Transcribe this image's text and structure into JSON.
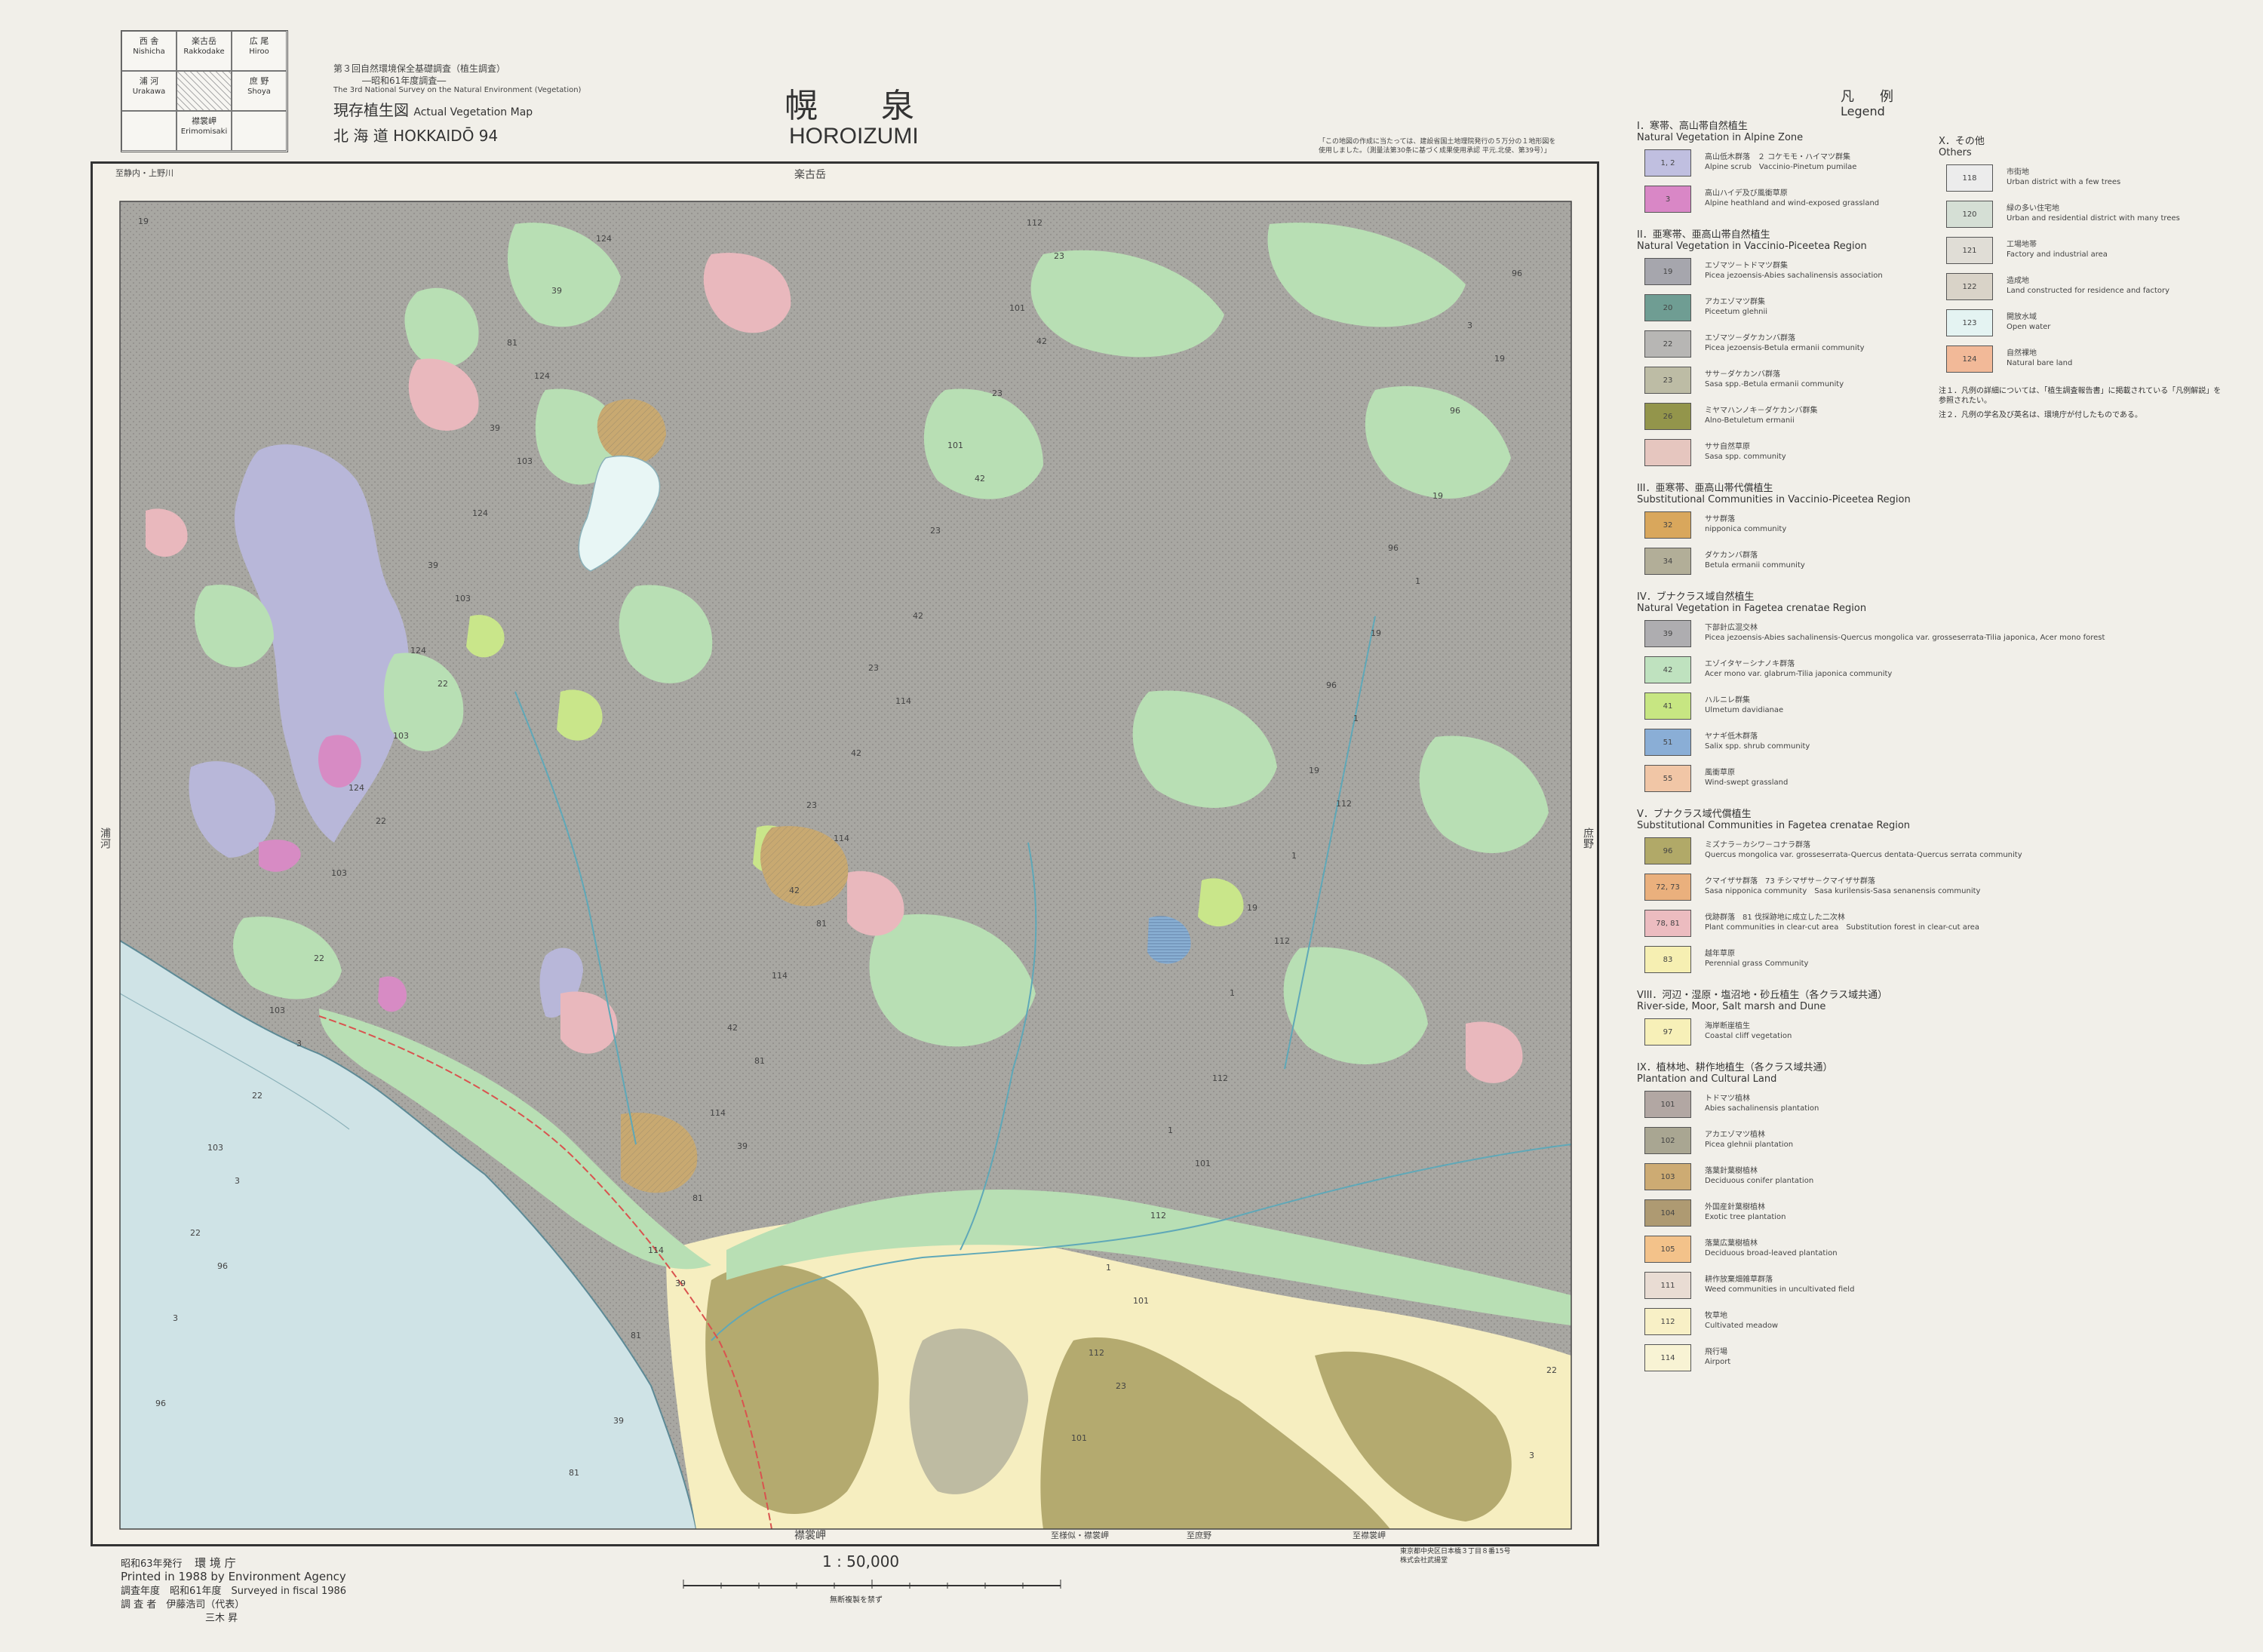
{
  "index_map": {
    "cells": [
      {
        "jp": "西 舎",
        "en": "Nishicha"
      },
      {
        "jp": "楽古岳",
        "en": "Rakkodake"
      },
      {
        "jp": "広 尾",
        "en": "Hiroo"
      },
      {
        "jp": "浦 河",
        "en": "Urakawa"
      },
      {
        "jp": "",
        "en": ""
      },
      {
        "jp": "庶 野",
        "en": "Shoya"
      },
      {
        "jp": "",
        "en": ""
      },
      {
        "jp": "襟裳岬",
        "en": "Erimomisaki"
      },
      {
        "jp": "",
        "en": ""
      }
    ]
  },
  "header": {
    "survey_jp": "第３回自然環境保全基礎調査（植生調査）",
    "year_jp": "―昭和61年度調査―",
    "survey_en": "The 3rd National Survey on the Natural Environment (Vegetation)",
    "map_type_jp": "現存植生図",
    "map_type_en": "Actual Vegetation Map",
    "region": "北 海 道 HOKKAIDŌ 94",
    "title_jp": "幌　泉",
    "title_en": "HOROIZUMI",
    "note_jp_1": "「この地図の作成に当たっては、建設省国土地理院発行の５万分の１地形図を",
    "note_jp_2": "使用しました。（測量法第30条に基づく成果使用承認 平元.北使、第39号）」"
  },
  "map": {
    "edge_top": "楽古岳",
    "edge_bottom": "襟裳岬",
    "edge_left": "浦河",
    "edge_right": "庶野",
    "top_left_ref": "至静内・上野川",
    "bottom_refs": [
      "至様似・襟裳岬",
      "至庶野",
      "至襟裳岬"
    ],
    "colors": {
      "sea": "#cfe3e6",
      "forest_mixed": "#a8a7a2",
      "alpine": "#b8b7d9",
      "broadleaf": "#b8dfb4",
      "oak": "#b4aa6f",
      "meadow": "#f6eec0",
      "clearcut": "#e9b8bd",
      "alpine_heath": "#d78bc4",
      "plantation": "#c8a971",
      "birch": "#bebba2",
      "ulmus": "#c9e68a",
      "willow": "#8ab0d4"
    }
  },
  "legend": {
    "title_jp": "凡　例",
    "title_en": "Legend",
    "sections": [
      {
        "heading_jp": "I．寒帯、高山帯自然植生",
        "heading_en": "Natural Vegetation in Alpine Zone",
        "items": [
          {
            "code": "1, 2",
            "color": "#c0bfe0",
            "jp": "高山低木群落　２ コケモモ・ハイマツ群集",
            "en": "Alpine scrub　Vaccinio-Pinetum pumilae"
          },
          {
            "code": "3",
            "color": "#d987c6",
            "jp": "高山ハイデ及び風衝草原",
            "en": "Alpine heathland and wind-exposed grassland"
          }
        ]
      },
      {
        "heading_jp": "II．亜寒帯、亜高山帯自然植生",
        "heading_en": "Natural Vegetation in Vaccinio-Piceetea Region",
        "items": [
          {
            "code": "19",
            "color": "#a6a6ad",
            "jp": "エゾマツ－トドマツ群集",
            "en": "Picea jezoensis-Abies sachalinensis association"
          },
          {
            "code": "20",
            "color": "#6f9d93",
            "jp": "アカエゾマツ群集",
            "en": "Piceetum glehnii"
          },
          {
            "code": "22",
            "color": "#b7b6b4",
            "jp": "エゾマツ－ダケカンバ群落",
            "en": "Picea jezoensis-Betula ermanii community"
          },
          {
            "code": "23",
            "color": "#bdbca5",
            "jp": "ササ－ダケカンバ群落",
            "en": "Sasa spp.-Betula ermanii community"
          },
          {
            "code": "26",
            "color": "#93954b",
            "jp": "ミヤマハンノキ－ダケカンバ群集",
            "en": "Alno-Betuletum ermanii"
          },
          {
            "code": "",
            "color": "#e6c6bf",
            "jp": "ササ自然草原",
            "en": "Sasa spp. community"
          }
        ]
      },
      {
        "heading_jp": "III．亜寒帯、亜高山帯代償植生",
        "heading_en": "Substitutional Communities in Vaccinio-Piceetea Region",
        "items": [
          {
            "code": "32",
            "color": "#d9a75c",
            "jp": "ササ群落",
            "en": "nipponica community"
          },
          {
            "code": "34",
            "color": "#b2ae98",
            "jp": "ダケカンバ群落",
            "en": "Betula ermanii community"
          }
        ]
      },
      {
        "heading_jp": "IV．ブナクラス域自然植生",
        "heading_en": "Natural Vegetation in Fagetea crenatae Region",
        "items": [
          {
            "code": "39",
            "color": "#aeadb0",
            "jp": "下部針広混交林",
            "en": "Picea jezoensis-Abies sachalinensis-Quercus mongolica var. grosseserrata-Tilia japonica, Acer mono forest"
          },
          {
            "code": "42",
            "color": "#bfe2bf",
            "jp": "エゾイタヤ－シナノキ群落",
            "en": "Acer mono var. glabrum-Tilia japonica community"
          },
          {
            "code": "41",
            "color": "#c7e682",
            "jp": "ハルニレ群集",
            "en": "Ulmetum davidianae"
          },
          {
            "code": "51",
            "color": "#8aaed6",
            "jp": "ヤナギ低木群落",
            "en": "Salix spp. shrub community"
          },
          {
            "code": "55",
            "color": "#f1c6a6",
            "jp": "風衝草原",
            "en": "Wind-swept grassland"
          }
        ]
      },
      {
        "heading_jp": "V．ブナクラス域代償植生",
        "heading_en": "Substitutional Communities in Fagetea crenatae Region",
        "items": [
          {
            "code": "96",
            "color": "#b1a968",
            "jp": "ミズナラ－カシワ－コナラ群落",
            "en": "Quercus mongolica var. grosseserrata-Quercus dentata-Quercus serrata community"
          },
          {
            "code": "72, 73",
            "color": "#eab07d",
            "jp": "クマイザサ群落　73 チシマザサ－クマイザサ群落",
            "en": "Sasa nipponica community　Sasa kurilensis-Sasa senanensis community"
          },
          {
            "code": "78, 81",
            "color": "#ecbcc0",
            "jp": "伐跡群落　81 伐採跡地に成立した二次林",
            "en": "Plant communities in clear-cut area　Substitution forest in clear-cut area"
          },
          {
            "code": "83",
            "color": "#f6efb2",
            "jp": "越年草原",
            "en": "Perennial grass Community"
          }
        ]
      },
      {
        "heading_jp": "VIII．河辺・湿原・塩沼地・砂丘植生（各クラス域共通）",
        "heading_en": "River-side, Moor, Salt marsh and Dune",
        "items": [
          {
            "code": "97",
            "color": "#f7f0b8",
            "jp": "海岸断崖植生",
            "en": "Coastal cliff vegetation"
          }
        ]
      },
      {
        "heading_jp": "IX．植林地、耕作地植生（各クラス域共通）",
        "heading_en": "Plantation and Cultural Land",
        "items": [
          {
            "code": "101",
            "color": "#b2a7a3",
            "jp": "トドマツ植林",
            "en": "Abies sachalinensis plantation"
          },
          {
            "code": "102",
            "color": "#a9a692",
            "jp": "アカエゾマツ植林",
            "en": "Picea glehnii plantation"
          },
          {
            "code": "103",
            "color": "#cdab73",
            "jp": "落葉針葉樹植林",
            "en": "Deciduous conifer plantation"
          },
          {
            "code": "104",
            "color": "#ae9a72",
            "jp": "外国産針葉樹植林",
            "en": "Exotic tree plantation"
          },
          {
            "code": "105",
            "color": "#f3c28a",
            "jp": "落葉広葉樹植林",
            "en": "Deciduous broad-leaved plantation"
          },
          {
            "code": "111",
            "color": "#e9dcd3",
            "jp": "耕作放棄畑雑草群落",
            "en": "Weed communities in uncultivated field"
          },
          {
            "code": "112",
            "color": "#f8f0c6",
            "jp": "牧草地",
            "en": "Cultivated meadow"
          },
          {
            "code": "114",
            "color": "#f8f3d4",
            "jp": "飛行場",
            "en": "Airport"
          }
        ]
      },
      {
        "heading_jp": "X．その他",
        "heading_en": "Others",
        "items": [
          {
            "code": "118",
            "color": "#ececec",
            "jp": "市街地",
            "en": "Urban district with a few trees"
          },
          {
            "code": "120",
            "color": "#d5dfd5",
            "jp": "緑の多い住宅地",
            "en": "Urban and residential district with many trees"
          },
          {
            "code": "121",
            "color": "#e0ddd6",
            "jp": "工場地帯",
            "en": "Factory and industrial area"
          },
          {
            "code": "122",
            "color": "#d9d3c8",
            "jp": "造成地",
            "en": "Land constructed for residence and factory"
          },
          {
            "code": "123",
            "color": "#e4f3f2",
            "jp": "開放水域",
            "en": "Open water"
          },
          {
            "code": "124",
            "color": "#f2b998",
            "jp": "自然裸地",
            "en": "Natural bare land"
          }
        ]
      }
    ],
    "notes": [
      "注１．凡例の詳細については、「植生調査報告書」に掲載されている「凡例解説」を参照されたい。",
      "注２．凡例の学名及び英名は、環境庁が付したものである。"
    ]
  },
  "footer": {
    "publish_jp": "昭和63年発行",
    "agency_jp": "環 境 庁",
    "printed_en": "Printed in 1988 by Environment Agency",
    "surveyed": "調査年度　昭和61年度　Surveyed in fiscal 1986",
    "surveyor": "調 査 者　伊藤浩司（代表）",
    "surveyor2": "三木 昇",
    "scale": "1 : 50,000",
    "scale_note": "無断複製を禁ず",
    "printer_1": "東京都中央区日本橋３丁目８番15号",
    "printer_2": "株式会社武揚堂"
  }
}
